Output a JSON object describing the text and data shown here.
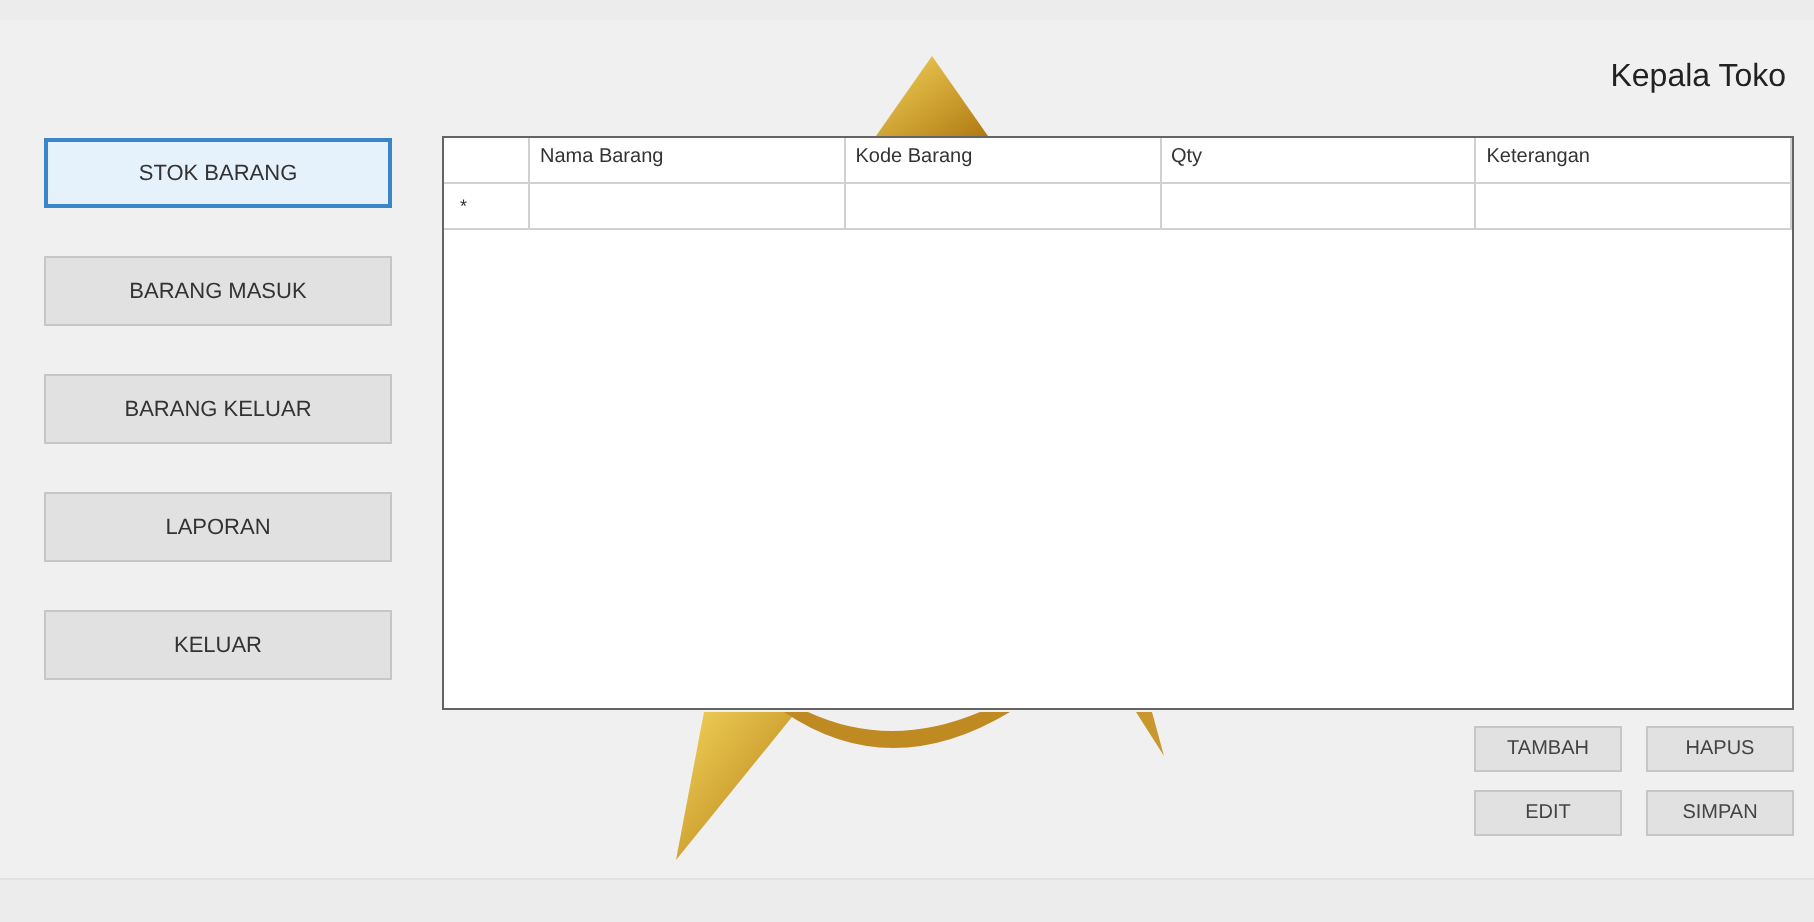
{
  "header": {
    "title": "Kepala Toko"
  },
  "nav": [
    {
      "label": "STOK BARANG",
      "selected": true
    },
    {
      "label": "BARANG MASUK",
      "selected": false
    },
    {
      "label": "BARANG KELUAR",
      "selected": false
    },
    {
      "label": "LAPORAN",
      "selected": false
    },
    {
      "label": "KELUAR",
      "selected": false
    }
  ],
  "table": {
    "columns": [
      "Nama Barang",
      "Kode Barang",
      "Qty",
      "Keterangan"
    ],
    "new_row_marker": "*"
  },
  "actions": [
    "TAMBAH",
    "HAPUS",
    "EDIT",
    "SIMPAN"
  ]
}
